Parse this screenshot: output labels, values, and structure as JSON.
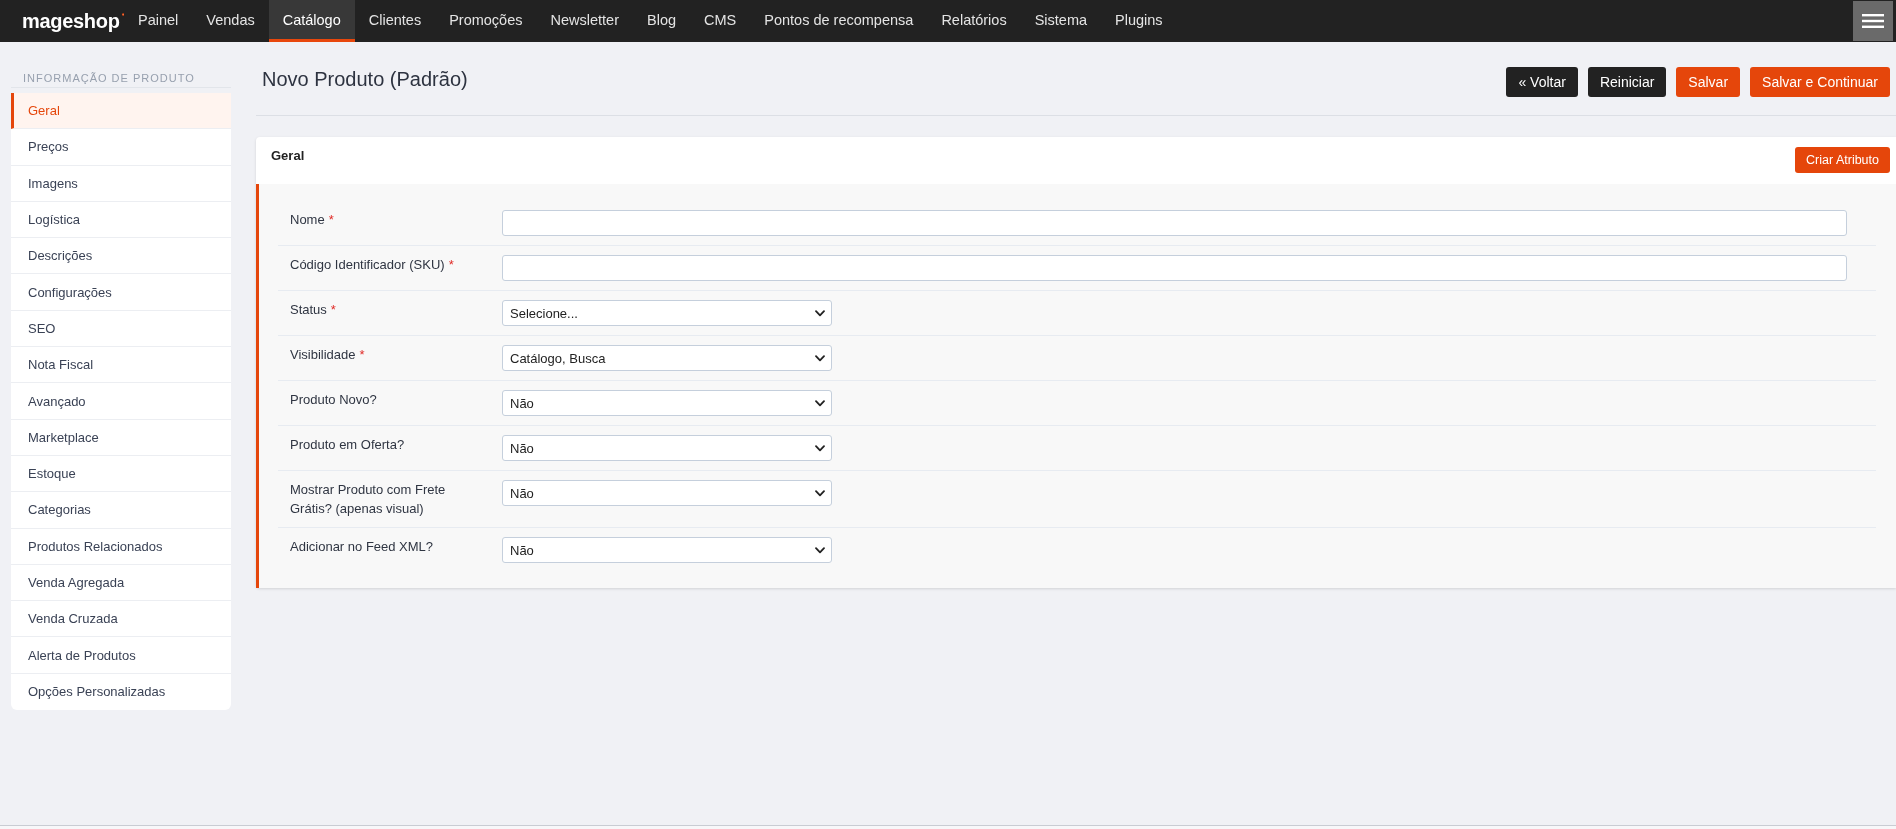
{
  "top_nav": {
    "logo": "mageshop",
    "items": [
      {
        "label": "Painel",
        "selected": false
      },
      {
        "label": "Vendas",
        "selected": false
      },
      {
        "label": "Catálogo",
        "selected": true
      },
      {
        "label": "Clientes",
        "selected": false
      },
      {
        "label": "Promoções",
        "selected": false
      },
      {
        "label": "Newsletter",
        "selected": false
      },
      {
        "label": "Blog",
        "selected": false
      },
      {
        "label": "CMS",
        "selected": false
      },
      {
        "label": "Pontos de recompensa",
        "selected": false
      },
      {
        "label": "Relatórios",
        "selected": false
      },
      {
        "label": "Sistema",
        "selected": false
      },
      {
        "label": "Plugins",
        "selected": false
      }
    ]
  },
  "sidebar": {
    "title": "INFORMAÇÃO DE PRODUTO",
    "items": [
      {
        "label": "Geral",
        "selected": true
      },
      {
        "label": "Preços",
        "selected": false
      },
      {
        "label": "Imagens",
        "selected": false
      },
      {
        "label": "Logística",
        "selected": false
      },
      {
        "label": "Descrições",
        "selected": false
      },
      {
        "label": "Configurações",
        "selected": false
      },
      {
        "label": "SEO",
        "selected": false
      },
      {
        "label": "Nota Fiscal",
        "selected": false
      },
      {
        "label": "Avançado",
        "selected": false
      },
      {
        "label": "Marketplace",
        "selected": false
      },
      {
        "label": "Estoque",
        "selected": false
      },
      {
        "label": "Categorias",
        "selected": false
      },
      {
        "label": "Produtos Relacionados",
        "selected": false
      },
      {
        "label": "Venda Agregada",
        "selected": false
      },
      {
        "label": "Venda Cruzada",
        "selected": false
      },
      {
        "label": "Alerta de Produtos",
        "selected": false
      },
      {
        "label": "Opções Personalizadas",
        "selected": false
      }
    ]
  },
  "header": {
    "title": "Novo Produto (Padrão)",
    "buttons": [
      {
        "label": "« Voltar",
        "kind": "dark"
      },
      {
        "label": "Reiniciar",
        "kind": "dark"
      },
      {
        "label": "Salvar",
        "kind": "primary"
      },
      {
        "label": "Salvar e Continuar",
        "kind": "primary"
      }
    ]
  },
  "panel": {
    "title": "Geral",
    "action": {
      "label": "Criar Atributo"
    },
    "fields": [
      {
        "label": "Nome",
        "required_mark": "*",
        "kind": "text"
      },
      {
        "label": "Código Identificador (SKU)",
        "required_mark": "*",
        "kind": "text"
      },
      {
        "label": "Status",
        "required_mark": "*",
        "kind": "select",
        "value": "Selecione..."
      },
      {
        "label": "Visibilidade",
        "required_mark": "*",
        "kind": "select",
        "value": "Catálogo, Busca"
      },
      {
        "label": "Produto Novo?",
        "kind": "select",
        "value": "Não"
      },
      {
        "label": "Produto em Oferta?",
        "kind": "select",
        "value": "Não"
      },
      {
        "label": "Mostrar Produto com Frete Grátis? (apenas visual)",
        "kind": "select",
        "value": "Não"
      },
      {
        "label": "Adicionar no Feed XML?",
        "kind": "select",
        "value": "Não"
      }
    ]
  }
}
